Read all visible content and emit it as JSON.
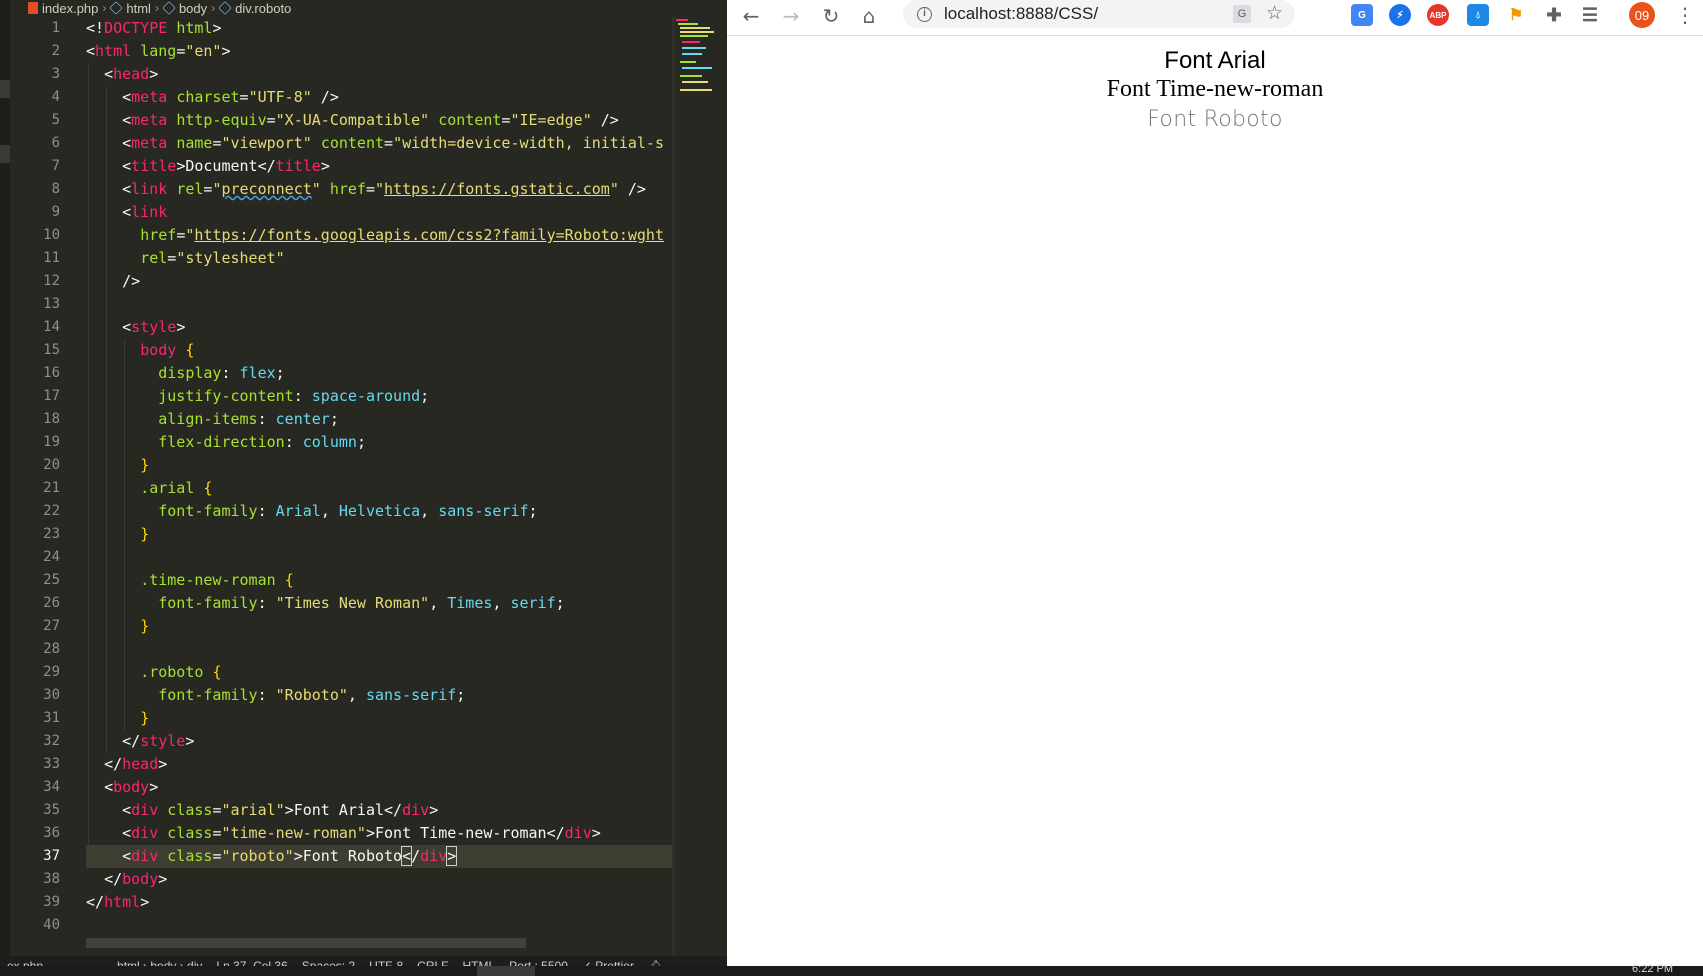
{
  "editor": {
    "breadcrumb": [
      "index.php",
      "html",
      "body",
      "div.roboto"
    ],
    "line_numbers": [
      "1",
      "2",
      "3",
      "4",
      "5",
      "6",
      "7",
      "8",
      "9",
      "10",
      "11",
      "12",
      "13",
      "14",
      "15",
      "16",
      "17",
      "18",
      "19",
      "20",
      "21",
      "22",
      "23",
      "24",
      "25",
      "26",
      "27",
      "28",
      "29",
      "30",
      "31",
      "32",
      "33",
      "34",
      "35",
      "36",
      "37",
      "38",
      "39",
      "40"
    ],
    "lines": [
      "<!DOCTYPE html>",
      "<html lang=\"en\">",
      "  <head>",
      "    <meta charset=\"UTF-8\" />",
      "    <meta http-equiv=\"X-UA-Compatible\" content=\"IE=edge\" />",
      "    <meta name=\"viewport\" content=\"width=device-width, initial-s",
      "    <title>Document</title>",
      "    <link rel=\"preconnect\" href=\"https://fonts.gstatic.com\" />",
      "    <link",
      "      href=\"https://fonts.googleapis.com/css2?family=Roboto:wght",
      "      rel=\"stylesheet\"",
      "    />",
      "",
      "    <style>",
      "      body {",
      "        display: flex;",
      "        justify-content: space-around;",
      "        align-items: center;",
      "        flex-direction: column;",
      "      }",
      "      .arial {",
      "        font-family: Arial, Helvetica, sans-serif;",
      "      }",
      "",
      "      .time-new-roman {",
      "        font-family: \"Times New Roman\", Times, serif;",
      "      }",
      "",
      "      .roboto {",
      "        font-family: \"Roboto\", sans-serif;",
      "      }",
      "    </style>",
      "  </head>",
      "  <body>",
      "    <div class=\"arial\">Font Arial</div>",
      "    <div class=\"time-new-roman\">Font Time-new-roman</div>",
      "    <div class=\"roboto\">Font Roboto</div>",
      "  </body>",
      "</html>",
      ""
    ],
    "active_line": 37,
    "status": {
      "file": "ex.php",
      "path": "html › body › div",
      "position": "Ln 37, Col 36",
      "spaces": "Spaces: 2",
      "encoding": "UTF-8",
      "eol": "CRLF",
      "language": "HTML",
      "port": "Port : 5500",
      "prettier": "✓ Prettier"
    }
  },
  "browser": {
    "url": "localhost:8888/CSS/",
    "avatar": "09",
    "extensions": [
      "translate-ext",
      "lightning-ext",
      "ABP",
      "drop-ext",
      "tag-ext",
      "puzzle-ext",
      "playlist-ext"
    ],
    "page": {
      "arial": "Font Arial",
      "times": "Font Time-new-roman",
      "roboto": "Font Roboto"
    }
  },
  "taskbar": {
    "clock": "6:22 PM"
  },
  "colors": {
    "editor_bg": "#272822",
    "tag": "#f92672",
    "attr": "#a6e22e",
    "string": "#e6db74",
    "value": "#66d9ef",
    "avatar": "#e8521c"
  }
}
